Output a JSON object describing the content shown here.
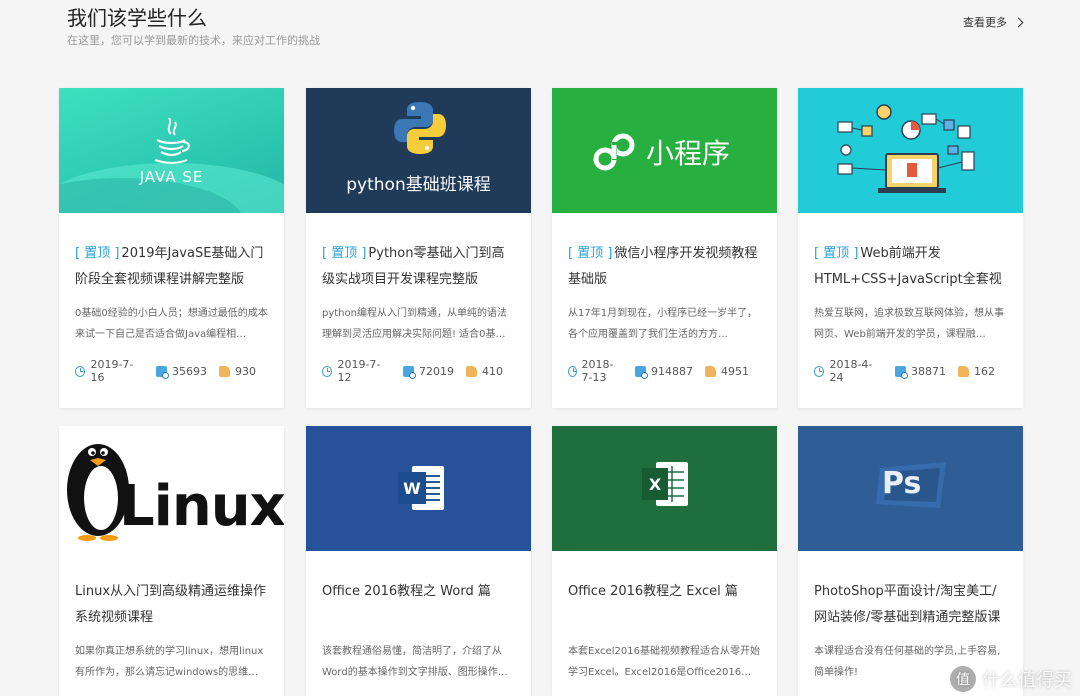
{
  "header": {
    "title": "我们该学些什么",
    "subtitle": "在这里，您可以学到最新的技术，来应对工作的挑战",
    "more_label": "查看更多"
  },
  "cards": [
    {
      "thumb_label": "JAVA SE",
      "top_tag": "[ 置顶 ]",
      "title": "2019年JavaSE基础入门阶段全套视频课程讲解完整版",
      "desc": "0基础0经验的小白人员；想通过最低的成本来试一下自己是否适合做Java编程相…",
      "date": "2019-7-16",
      "views": "35693",
      "likes": "930"
    },
    {
      "thumb_label": "python基础班课程",
      "top_tag": "[ 置顶 ]",
      "title": "Python零基础入门到高级实战项目开发课程完整版",
      "desc": "python编程从入门到精通，从单纯的语法理解到灵活应用解决实际问题! 适合0基…",
      "date": "2019-7-12",
      "views": "72019",
      "likes": "410"
    },
    {
      "thumb_label": "小程序",
      "top_tag": "[ 置顶 ]",
      "title": "微信小程序开发视频教程基础版",
      "desc": "从17年1月到现在，小程序已经一岁半了，各个应用覆盖到了我们生活的方方…",
      "date": "2018-7-13",
      "views": "914887",
      "likes": "4951"
    },
    {
      "thumb_label": "",
      "top_tag": "[ 置顶 ]",
      "title": "Web前端开发HTML+CSS+JavaScript全套视频精英课程",
      "desc": "热爱互联网，追求极致互联网体验，想从事网页、Web前端开发的学员，课程融…",
      "date": "2018-4-24",
      "views": "38871",
      "likes": "162"
    },
    {
      "thumb_label": "Linux",
      "title": "Linux从入门到高级精通运维操作系统视频课程",
      "desc": "如果你真正想系统的学习linux，想用linux有所作为，那么请忘记windows的思维…"
    },
    {
      "thumb_label": "",
      "title": "Office 2016教程之 Word 篇",
      "desc": "该套教程通俗易懂，简洁明了，介绍了从Word的基本操作到文字排版、图形操作…"
    },
    {
      "thumb_label": "",
      "title": "Office 2016教程之 Excel 篇",
      "desc": "本套Excel2016基础视频教程适合从零开始学习Excel。Excel2016是Office2016…"
    },
    {
      "thumb_label": "Ps",
      "title": "PhotoShop平面设计/淘宝美工/网站装修/零基础到精通完整版课程",
      "desc": "本课程适合没有任何基础的学员,上手容易,简单操作!"
    }
  ],
  "watermark": {
    "badge": "值",
    "text": "什么值得买"
  },
  "colors": {
    "accent": "#2aa1d3",
    "page_bg": "#f5f5f5"
  },
  "icons": {
    "date": "clock-icon",
    "views": "view-count-icon",
    "likes": "thumbs-up-icon",
    "more": "chevron-right-icon"
  }
}
